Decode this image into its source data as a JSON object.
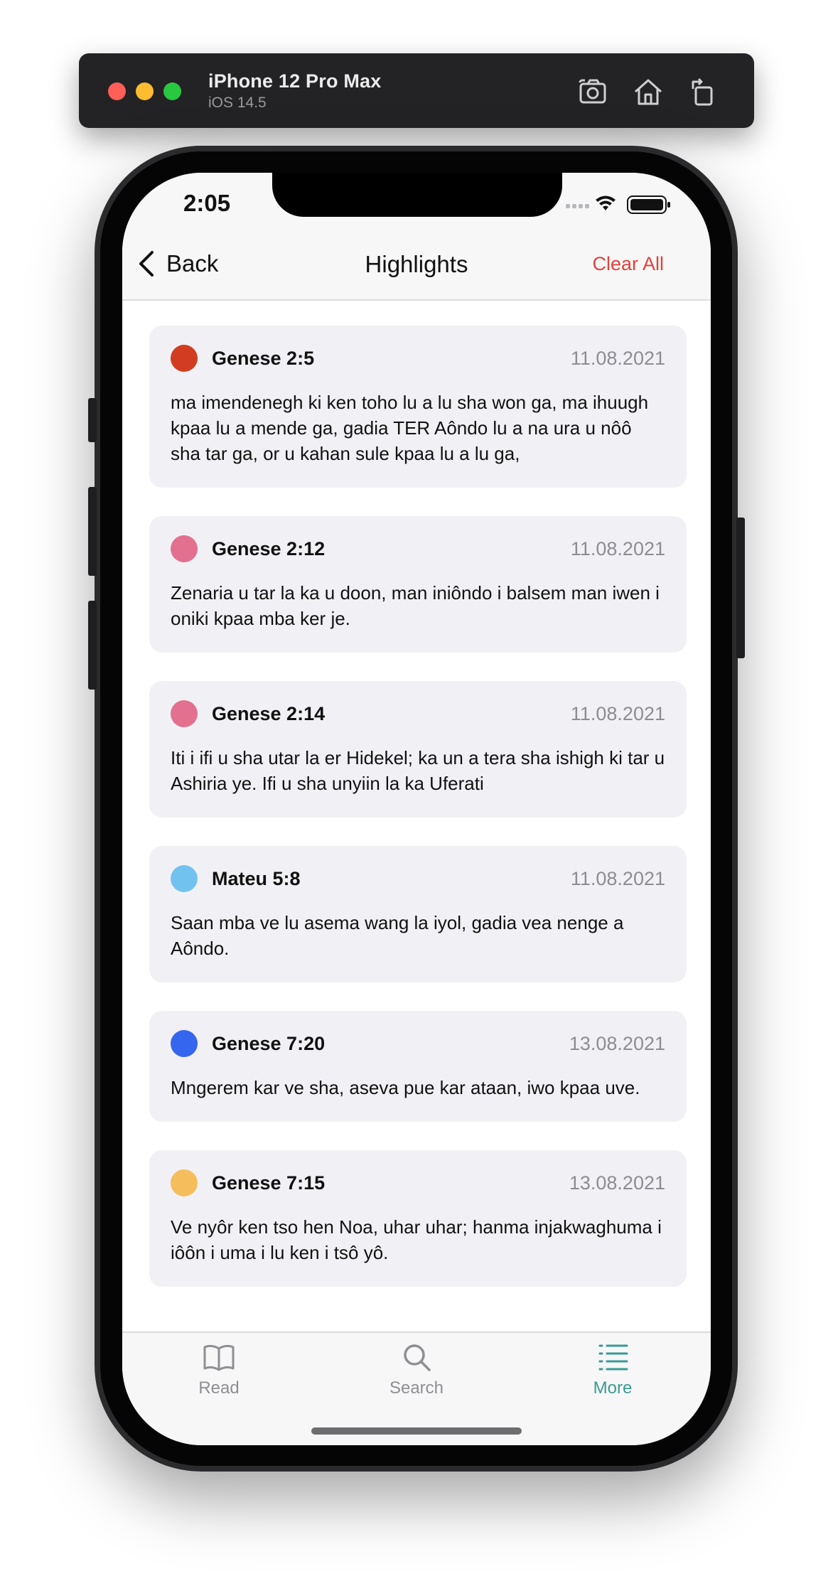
{
  "simulator": {
    "device_name": "iPhone 12 Pro Max",
    "os_version": "iOS 14.5",
    "icons": [
      "screenshot-icon",
      "home-icon",
      "rotate-icon"
    ]
  },
  "status_bar": {
    "time": "2:05"
  },
  "navbar": {
    "back_label": "Back",
    "title": "Highlights",
    "clear_label": "Clear All",
    "clear_color": "#e0433a"
  },
  "highlights": [
    {
      "color": "#d23d22",
      "ref": "Genese 2:5",
      "date": "11.08.2021",
      "text": "ma imendenegh ki ken toho lu a lu sha won ga, ma ihuugh kpaa lu a mende ga, gadia TER Aôndo lu a na ura u nôô sha tar ga, or u kahan sule kpaa lu a lu ga,"
    },
    {
      "color": "#e3708f",
      "ref": "Genese 2:12",
      "date": "11.08.2021",
      "text": "Zenaria u tar la ka u doon, man iniôndo i balsem man iwen i oniki kpaa mba ker je."
    },
    {
      "color": "#e3708f",
      "ref": "Genese 2:14",
      "date": "11.08.2021",
      "text": "Iti i ifi u sha utar la er Hidekel; ka un a tera sha ishigh ki tar u Ashiria ye. Ifi u sha unyiin la ka Uferati"
    },
    {
      "color": "#72c2f0",
      "ref": "Mateu 5:8",
      "date": "11.08.2021",
      "text": "Saan mba ve lu asema wang la iyol, gadia vea nenge a Aôndo."
    },
    {
      "color": "#3566f0",
      "ref": "Genese 7:20",
      "date": "13.08.2021",
      "text": "Mngerem kar ve sha, aseva pue kar ataan, iwo kpaa uve."
    },
    {
      "color": "#f5bd5c",
      "ref": "Genese 7:15",
      "date": "13.08.2021",
      "text": "Ve nyôr ken tso hen Noa, uhar uhar; hanma injakwaghuma i iôôn i uma i lu ken i tsô yô."
    }
  ],
  "tabs": [
    {
      "label": "Read",
      "icon": "book-icon",
      "active": false
    },
    {
      "label": "Search",
      "icon": "search-icon",
      "active": false
    },
    {
      "label": "More",
      "icon": "list-icon",
      "active": true
    }
  ],
  "colors": {
    "tab_active": "#3a9a92",
    "tab_inactive": "#8e8e93"
  }
}
